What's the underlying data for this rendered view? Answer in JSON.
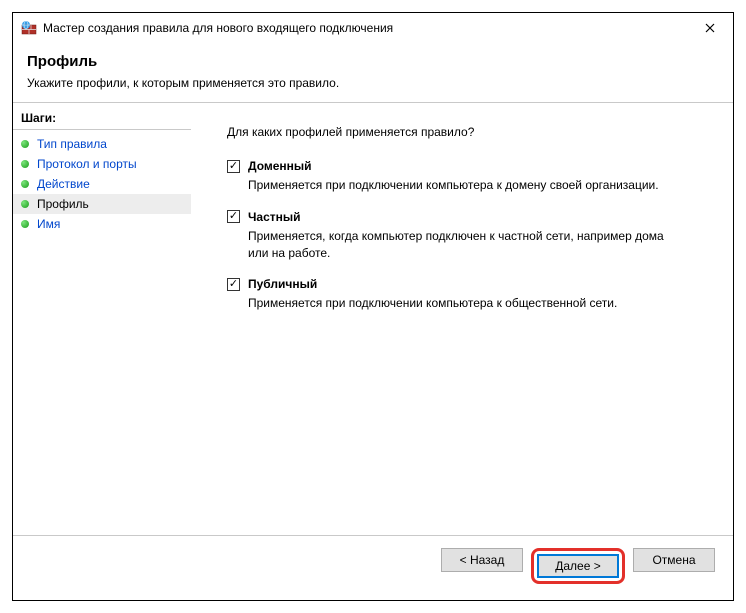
{
  "window": {
    "title": "Мастер создания правила для нового входящего подключения"
  },
  "header": {
    "title": "Профиль",
    "subtitle": "Укажите профили, к которым применяется это правило."
  },
  "sidebar": {
    "steps_label": "Шаги:",
    "items": [
      {
        "label": "Тип правила",
        "current": false
      },
      {
        "label": "Протокол и порты",
        "current": false
      },
      {
        "label": "Действие",
        "current": false
      },
      {
        "label": "Профиль",
        "current": true
      },
      {
        "label": "Имя",
        "current": false
      }
    ]
  },
  "content": {
    "question": "Для каких профилей применяется правило?",
    "options": [
      {
        "label": "Доменный",
        "desc": "Применяется при подключении компьютера к домену своей организации.",
        "checked": true
      },
      {
        "label": "Частный",
        "desc": "Применяется, когда компьютер подключен к частной сети, например дома или на работе.",
        "checked": true
      },
      {
        "label": "Публичный",
        "desc": "Применяется при подключении компьютера к общественной сети.",
        "checked": true
      }
    ]
  },
  "footer": {
    "back": "< Назад",
    "next": "Далее >",
    "cancel": "Отмена"
  }
}
